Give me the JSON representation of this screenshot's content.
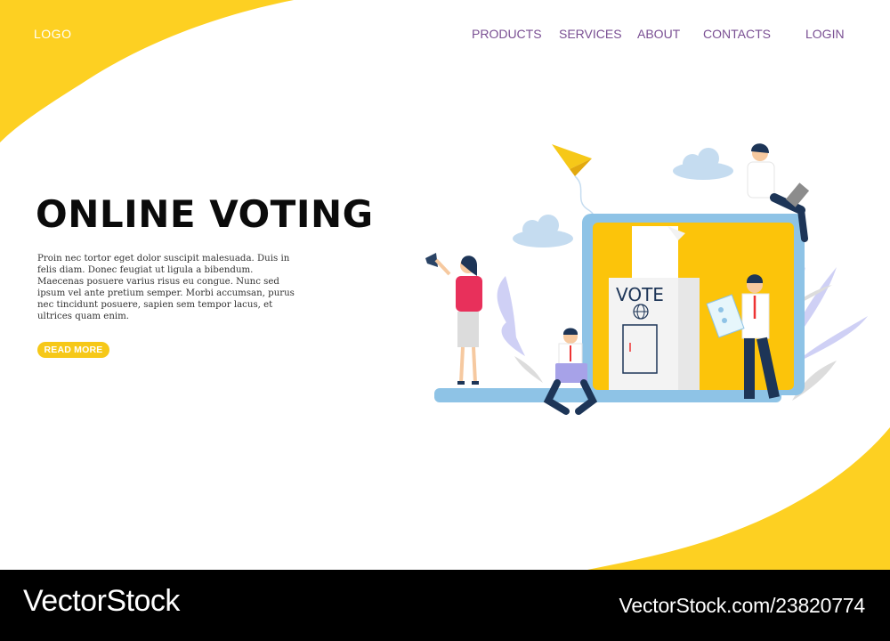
{
  "header": {
    "logo": "LOGO",
    "nav": [
      {
        "label": "PRODUCTS"
      },
      {
        "label": "SERVICES"
      },
      {
        "label": "ABOUT"
      },
      {
        "label": "CONTACTS"
      },
      {
        "label": "LOGIN"
      }
    ]
  },
  "hero": {
    "title": "ONLINE VOTING",
    "body": "Proin nec tortor eget dolor suscipit malesuada. Duis in felis diam. Donec feugiat ut ligula a bibendum. Maecenas posuere varius risus eu congue. Nunc sed ipsum vel ante pretium semper. Morbi accumsan, purus nec tincidunt posuere, sapien sem tempor lacus, et ultrices quam enim.",
    "button": "READ MORE"
  },
  "illustration": {
    "ballot_box_label": "VOTE"
  },
  "footer": {
    "brand": "VectorStock",
    "id": "VectorStock.com/23820774"
  },
  "colors": {
    "accent_yellow": "#fdd022",
    "nav_text": "#7a4f93",
    "laptop_blue": "#8ec3e6",
    "footer_bg": "#000000"
  }
}
